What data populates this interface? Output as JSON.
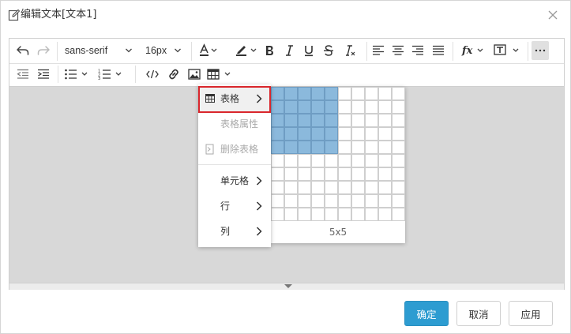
{
  "dialog": {
    "title": "编辑文本[文本1]",
    "close_icon": "close-icon"
  },
  "toolbar": {
    "row1": {
      "undo_icon": "undo-icon",
      "redo_icon": "redo-icon",
      "font_family": "sans-serif",
      "font_size": "16px",
      "text_color_icon": "text-color-icon",
      "highlight_icon": "highlight-icon",
      "bold_icon": "bold-icon",
      "italic_icon": "italic-icon",
      "underline_icon": "underline-icon",
      "strikethrough_icon": "strikethrough-icon",
      "clear_format_icon": "clear-format-icon",
      "align_left_icon": "align-left-icon",
      "align_center_icon": "align-center-icon",
      "align_right_icon": "align-right-icon",
      "align_justify_icon": "align-justify-icon",
      "formula_icon": "formula-icon",
      "text_box_icon": "text-box-icon",
      "more_icon": "more-icon"
    },
    "row2": {
      "outdent_icon": "outdent-icon",
      "indent_icon": "indent-icon",
      "bullet_list_icon": "bullet-list-icon",
      "numbered_list_icon": "numbered-list-icon",
      "code_icon": "code-icon",
      "link_icon": "link-icon",
      "image_icon": "image-icon",
      "table_icon": "table-icon"
    }
  },
  "table_menu": {
    "items": [
      {
        "label": "表格",
        "state": "active",
        "has_submenu": true
      },
      {
        "label": "表格属性",
        "state": "disabled",
        "has_submenu": false
      },
      {
        "label": "删除表格",
        "state": "disabled",
        "has_submenu": false
      },
      {
        "label": "单元格",
        "state": "enabled",
        "has_submenu": true
      },
      {
        "label": "行",
        "state": "enabled",
        "has_submenu": true
      },
      {
        "label": "列",
        "state": "enabled",
        "has_submenu": true
      }
    ]
  },
  "grid_picker": {
    "columns": 10,
    "rows": 10,
    "selected_cols": 5,
    "selected_rows": 5,
    "selection_label": "5x5",
    "selected_color": "#8bb9dc",
    "selected_border": "#6f9dc3"
  },
  "buttons": {
    "ok_label": "确定",
    "cancel_label": "取消",
    "apply_label": "应用"
  },
  "colors": {
    "accent": "#2d9cd1",
    "highlight_border": "#d9262c",
    "content_bg": "#d8d8d8"
  }
}
